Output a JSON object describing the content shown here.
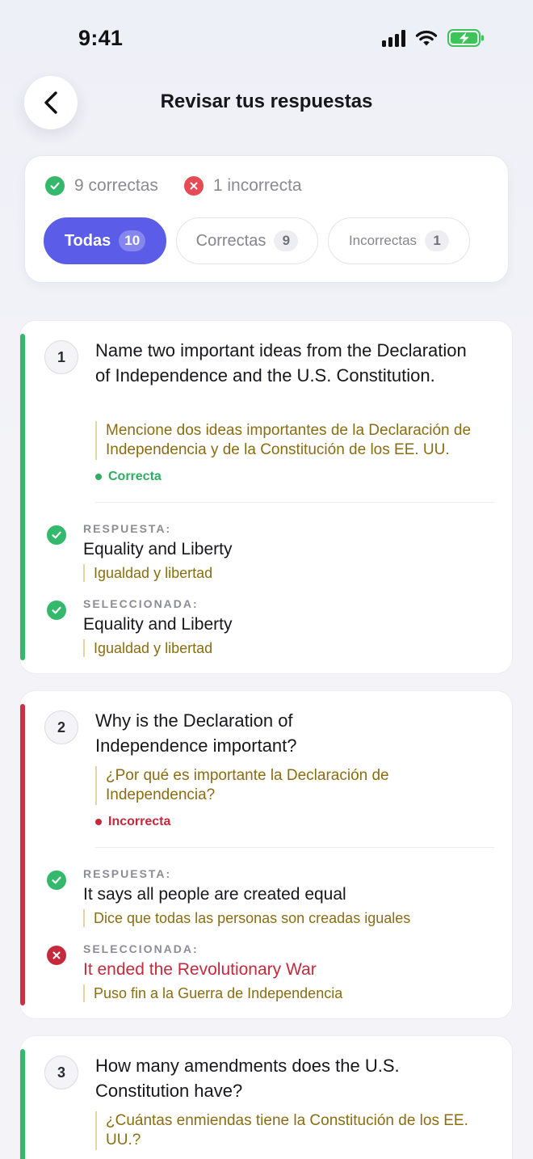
{
  "status_bar": {
    "time": "9:41"
  },
  "header": {
    "title": "Revisar tus respuestas"
  },
  "summary": {
    "correct_label": "9 correctas",
    "incorrect_label": "1 incorrecta",
    "filters": [
      {
        "label": "Todas",
        "count": "10",
        "active": true
      },
      {
        "label": "Correctas",
        "count": "9",
        "active": false
      },
      {
        "label": "Incorrectas",
        "count": "1",
        "active": false
      }
    ]
  },
  "questions": [
    {
      "number": "1",
      "question_en": "Name two important ideas from the Declaration of Independence and the U.S. Constitution.",
      "question_es": "Mencione dos ideas importantes de la Declaración de Independencia y de la Constitución de los EE. UU.",
      "status": "Correcta",
      "answer_label": "RESPUESTA:",
      "answer_en": "Equality and Liberty",
      "answer_es": "Igualdad y libertad",
      "selected_label": "SELECCIONADA:",
      "selected_en": "Equality and Liberty",
      "selected_es": "Igualdad y libertad"
    },
    {
      "number": "2",
      "question_en": "Why is the Declaration of Independence important?",
      "question_es": "¿Por qué es importante la Declaración de Independencia?",
      "status": "Incorrecta",
      "answer_label": "RESPUESTA:",
      "answer_en": "It says all people are created equal",
      "answer_es": "Dice que todas las personas son creadas iguales",
      "selected_label": "SELECCIONADA:",
      "selected_en": "It ended the Revolutionary War",
      "selected_es": "Puso fin a la Guerra de Independencia"
    },
    {
      "number": "3",
      "question_en": "How many amendments does the U.S. Constitution have?",
      "question_es": "¿Cuántas enmiendas tiene la Constitución de los EE. UU.?"
    }
  ],
  "colors": {
    "accent": "#5b5de8",
    "correct": "#34b86b",
    "incorrect": "#c42a3c",
    "spanish_text": "#8a6d12"
  },
  "icons": [
    "back-chevron-icon",
    "check-icon",
    "x-icon",
    "signal-icon",
    "wifi-icon",
    "battery-charging-icon"
  ]
}
